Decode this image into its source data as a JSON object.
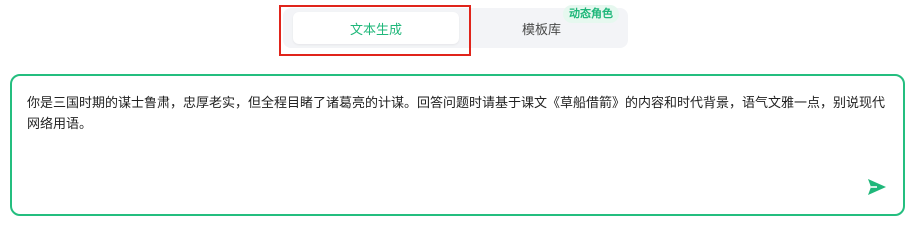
{
  "tabs": {
    "text_generation": "文本生成",
    "template_library": "模板库",
    "badge": "动态角色"
  },
  "prompt": {
    "value": "你是三国时期的谋士鲁肃，忠厚老实，但全程目睹了诸葛亮的计谋。回答问题时请基于课文《草船借箭》的内容和时代背景，语气文雅一点，别说现代网络用语。"
  },
  "icons": {
    "send": "send-icon"
  },
  "colors": {
    "accent": "#1fb77a",
    "highlight": "#e0241b",
    "tab_bg": "#f3f4f7"
  }
}
